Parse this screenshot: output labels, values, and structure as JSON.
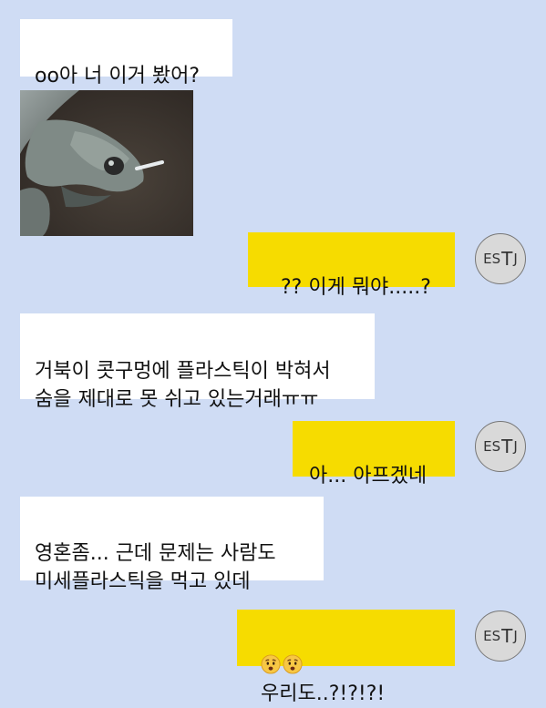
{
  "messages": [
    {
      "side": "left",
      "text": "oo아 너 이거 봤어?"
    },
    {
      "side": "left",
      "type": "image",
      "alt": "turtle-with-plastic-straw-photo"
    },
    {
      "side": "right",
      "text": "?? 이게 뭐야.....?"
    },
    {
      "side": "left",
      "text": "거북이 콧구멍에 플라스틱이 박혀서\n숨을 제대로 못 쉬고 있는거래ㅠㅠ"
    },
    {
      "side": "right",
      "text": "아... 아프겠네"
    },
    {
      "side": "left",
      "text": "영혼좀... 근데 문제는 사람도\n미세플라스틱을 먹고 있데"
    },
    {
      "side": "right",
      "text": "우리도..?!?!?!",
      "emoji": [
        "worried-face",
        "worried-face"
      ]
    }
  ],
  "avatar": {
    "parts": [
      "ES",
      "T",
      "J"
    ]
  },
  "colors": {
    "background": "#cfdcf4",
    "left_bubble": "#ffffff",
    "right_bubble": "#f6dc00"
  }
}
